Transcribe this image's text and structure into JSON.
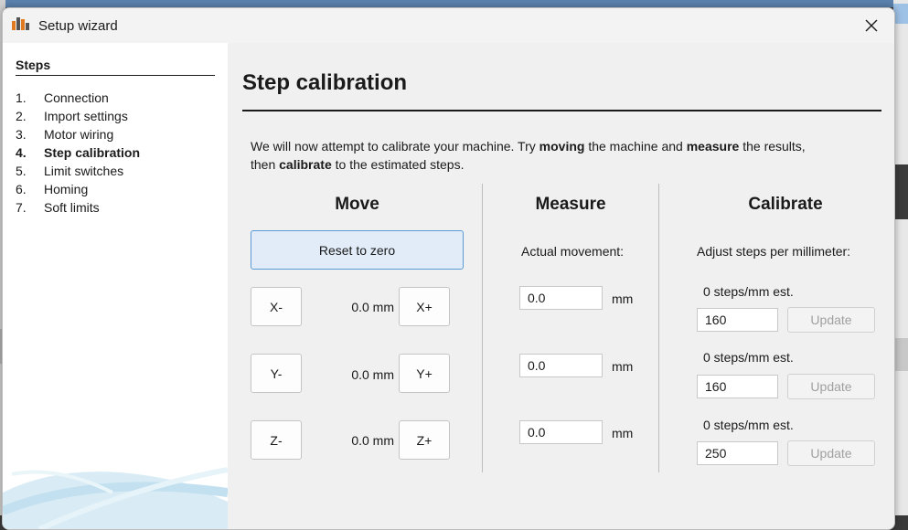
{
  "window": {
    "title": "Setup wizard"
  },
  "sidebar": {
    "heading": "Steps",
    "items": [
      {
        "num": "1.",
        "label": "Connection",
        "active": false
      },
      {
        "num": "2.",
        "label": "Import settings",
        "active": false
      },
      {
        "num": "3.",
        "label": "Motor wiring",
        "active": false
      },
      {
        "num": "4.",
        "label": "Step calibration",
        "active": true
      },
      {
        "num": "5.",
        "label": "Limit switches",
        "active": false
      },
      {
        "num": "6.",
        "label": "Homing",
        "active": false
      },
      {
        "num": "7.",
        "label": "Soft limits",
        "active": false
      }
    ]
  },
  "page": {
    "title": "Step calibration",
    "intro": {
      "p1": "We will now attempt to calibrate your machine. Try ",
      "b1": "moving",
      "p2": " the machine and ",
      "b2": "measure",
      "p3": " the results,",
      "p4": "then ",
      "b3": "calibrate",
      "p5": " to the estimated steps."
    }
  },
  "move": {
    "heading": "Move",
    "reset_label": "Reset to zero",
    "axes": [
      {
        "minus": "X-",
        "plus": "X+",
        "position": "0.0 mm"
      },
      {
        "minus": "Y-",
        "plus": "Y+",
        "position": "0.0 mm"
      },
      {
        "minus": "Z-",
        "plus": "Z+",
        "position": "0.0 mm"
      }
    ]
  },
  "measure": {
    "heading": "Measure",
    "label": "Actual movement:",
    "unit": "mm",
    "values": [
      "0.0",
      "0.0",
      "0.0"
    ]
  },
  "calibrate": {
    "heading": "Calibrate",
    "label": "Adjust steps per millimeter:",
    "update_label": "Update",
    "rows": [
      {
        "estimate": "0 steps/mm est.",
        "value": "160"
      },
      {
        "estimate": "0 steps/mm est.",
        "value": "160"
      },
      {
        "estimate": "0 steps/mm est.",
        "value": "250"
      }
    ]
  },
  "colors": {
    "accent_border": "#5b9bd5",
    "accent_fill": "#e1ecf8",
    "disabled_text": "#a0a0a0",
    "app_icon": "#e07b22"
  }
}
